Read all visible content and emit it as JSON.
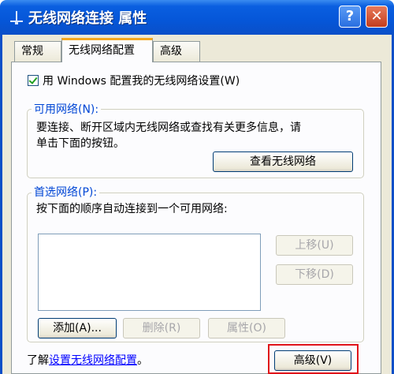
{
  "window": {
    "title": "无线网络连接 属性",
    "help_label": "?",
    "close_label": "✕"
  },
  "tabs": [
    {
      "label": "常规"
    },
    {
      "label": "无线网络配置"
    },
    {
      "label": "高级"
    }
  ],
  "wireless_config": {
    "use_windows_label": "用 Windows 配置我的无线网络设置(W)",
    "available": {
      "title": "可用网络(N):",
      "description_line1": "要连接、断开区域内无线网络或查找有关更多信息，请",
      "description_line2": "单击下面的按钮。",
      "view_button": "查看无线网络"
    },
    "preferred": {
      "title": "首选网络(P):",
      "description": "按下面的顺序自动连接到一个可用网络:",
      "move_up": "上移(U)",
      "move_down": "下移(D)",
      "add": "添加(A)...",
      "remove": "删除(R)",
      "properties": "属性(O)"
    },
    "learn_prefix": "了解",
    "learn_link": "设置无线网络配置",
    "learn_suffix": "。",
    "advanced_button": "高级(V)"
  }
}
